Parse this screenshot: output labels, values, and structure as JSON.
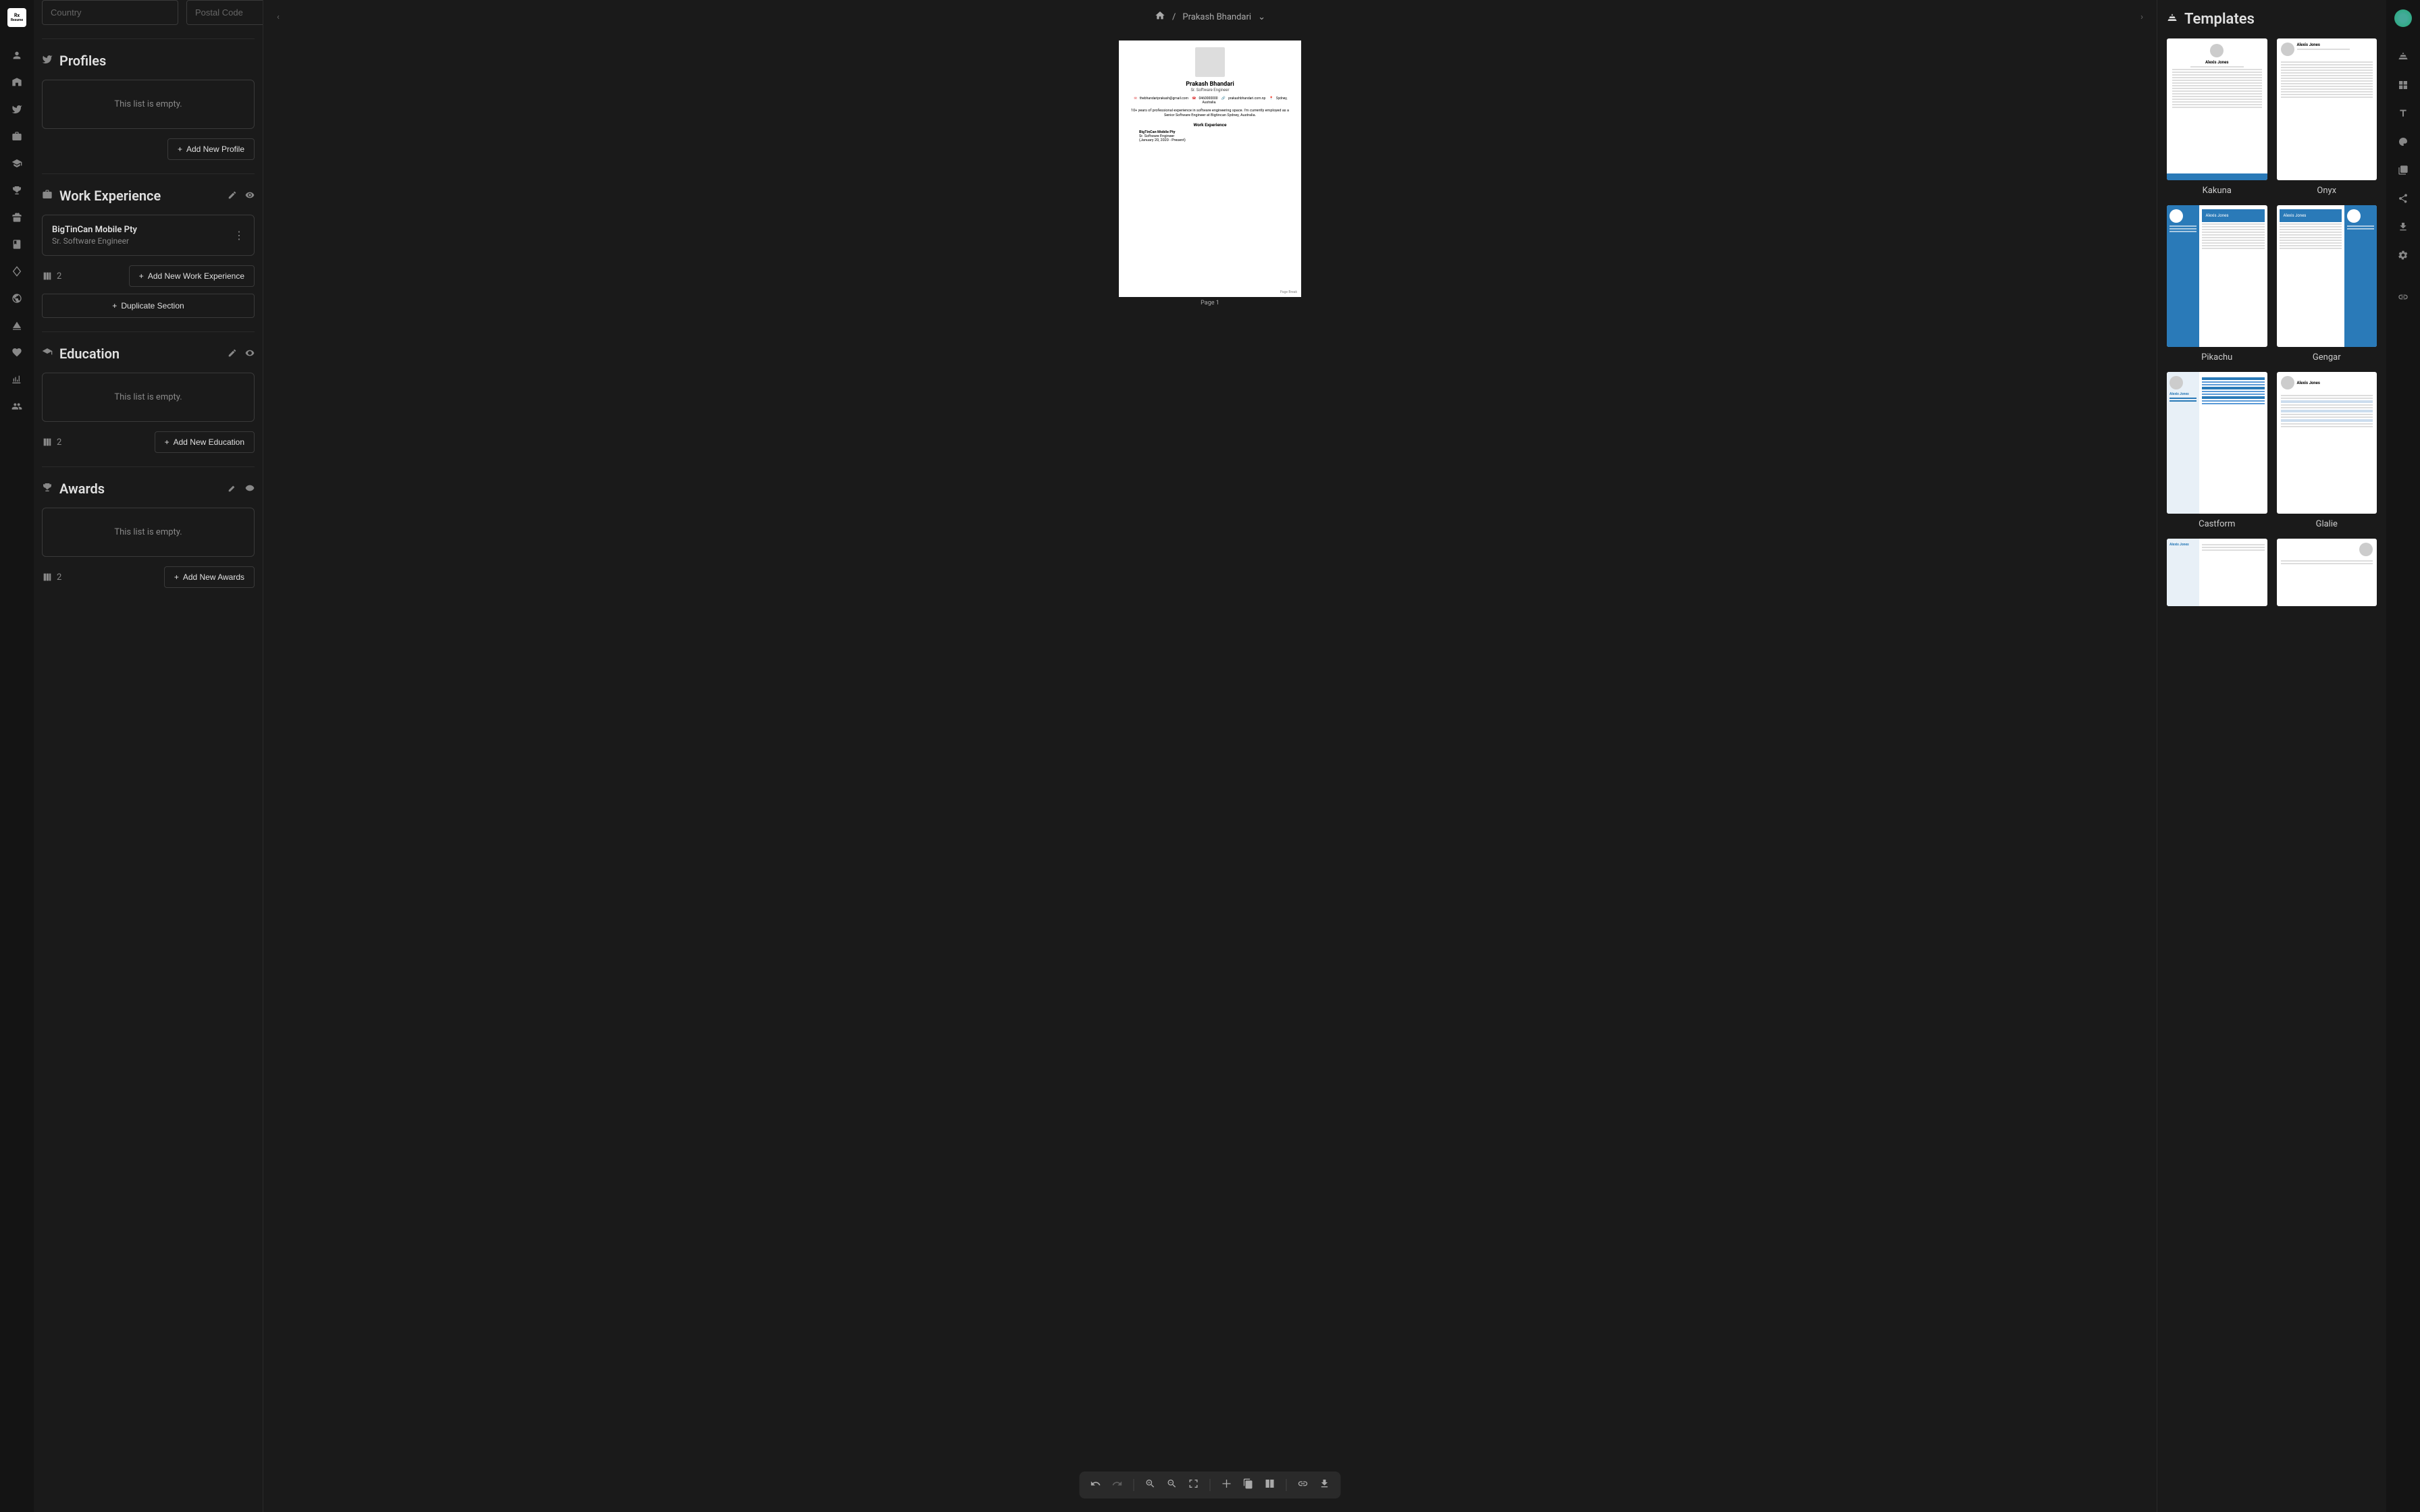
{
  "app": {
    "logo_top": "Rx",
    "logo_bottom": "Resume"
  },
  "breadcrumb": {
    "name": "Prakash Bhandari"
  },
  "left_panel": {
    "country_placeholder": "Country",
    "postal_placeholder": "Postal Code",
    "sections": {
      "profiles": {
        "title": "Profiles",
        "empty": "This list is empty.",
        "add_btn": "Add New Profile"
      },
      "work": {
        "title": "Work Experience",
        "item": {
          "company": "BigTinCan Mobile Pty",
          "role": "Sr. Software Engineer"
        },
        "columns": "2",
        "add_btn": "Add New Work Experience",
        "duplicate_btn": "Duplicate Section"
      },
      "education": {
        "title": "Education",
        "empty": "This list is empty.",
        "columns": "2",
        "add_btn": "Add New Education"
      },
      "awards": {
        "title": "Awards",
        "empty": "This list is empty.",
        "columns": "2",
        "add_btn": "Add New Awards"
      }
    }
  },
  "resume": {
    "name": "Prakash Bhandari",
    "role": "Sr. Software Engineer",
    "email": "thebhandariprakash@gmail.com",
    "phone": "0460000000",
    "website": "prakashbhandari.com.np",
    "location": "Sydney, Australia.",
    "summary": "10+ years of professional experience in software engineering space. I'm currently employed as a Senior Software Engineer at Bigtincan Sydney, Australia.",
    "work_section": "Work Experience",
    "job_company": "BigTinCan Mobile Pty",
    "job_role": "Sr. Software Engineer",
    "job_dates": "(January 20, 2020 - Present)",
    "page_break": "Page Break",
    "page_label": "Page 1"
  },
  "right_panel": {
    "title": "Templates",
    "templates": [
      {
        "name": "Kakuna"
      },
      {
        "name": "Onyx"
      },
      {
        "name": "Pikachu"
      },
      {
        "name": "Gengar"
      },
      {
        "name": "Castform"
      },
      {
        "name": "Glalie"
      }
    ]
  }
}
